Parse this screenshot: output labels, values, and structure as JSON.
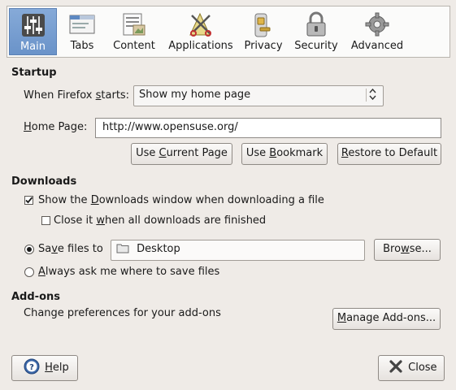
{
  "toolbar": {
    "panes": [
      {
        "label": "Main",
        "icon": "main-sliders-icon"
      },
      {
        "label": "Tabs",
        "icon": "tabs-icon"
      },
      {
        "label": "Content",
        "icon": "content-icon"
      },
      {
        "label": "Applications",
        "icon": "applications-icon"
      },
      {
        "label": "Privacy",
        "icon": "privacy-icon"
      },
      {
        "label": "Security",
        "icon": "lock-icon"
      },
      {
        "label": "Advanced",
        "icon": "gear-icon"
      }
    ],
    "active_pane": "Main",
    "active_color": "#7aa0d2"
  },
  "startup": {
    "heading": "Startup",
    "when_label_pre": "When Firefox ",
    "when_label_u": "s",
    "when_label_post": "tarts:",
    "startup_value": "Show my home page",
    "home_label_pre": "",
    "home_label_u": "H",
    "home_label_post": "ome Page:",
    "home_value": "http://www.opensuse.org/",
    "use_current_pre": "Use ",
    "use_current_u": "C",
    "use_current_post": "urrent Page",
    "use_bookmark_pre": "Use ",
    "use_bookmark_u": "B",
    "use_bookmark_post": "ookmark",
    "restore_pre": "",
    "restore_u": "R",
    "restore_post": "estore to Default"
  },
  "downloads": {
    "heading": "Downloads",
    "show_window_pre": "Show the ",
    "show_window_u": "D",
    "show_window_post": "ownloads window when downloading a file",
    "show_window_checked": true,
    "close_it_pre": "Close it ",
    "close_it_u": "w",
    "close_it_post": "hen all downloads are finished",
    "close_it_checked": false,
    "save_to_pre": "Sa",
    "save_to_u": "v",
    "save_to_post": "e files to",
    "save_to_selected": true,
    "folder": "Desktop",
    "browse_pre": "Bro",
    "browse_u": "w",
    "browse_post": "se...",
    "always_ask_pre": "",
    "always_ask_u": "A",
    "always_ask_post": "lways ask me where to save files",
    "always_ask_selected": false
  },
  "addons": {
    "heading": "Add-ons",
    "description": "Change preferences for your add-ons",
    "manage_pre": "",
    "manage_u": "M",
    "manage_post": "anage Add-ons..."
  },
  "footer": {
    "help_pre": "",
    "help_u": "H",
    "help_post": "elp",
    "close_label": "Close"
  }
}
